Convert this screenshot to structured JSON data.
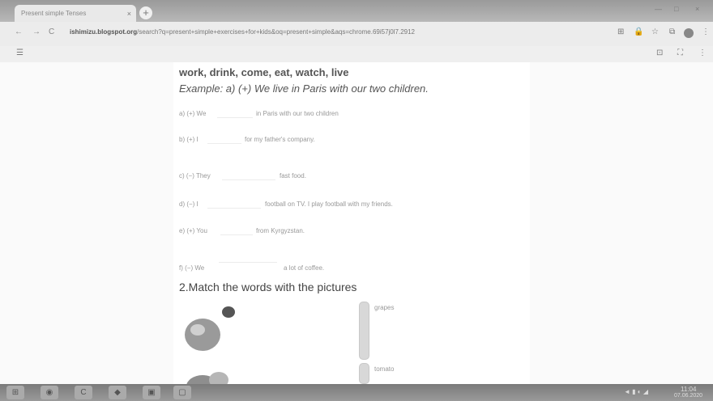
{
  "browser": {
    "tab_title": "Present simple Tenses",
    "tab_close": "×",
    "new_tab": "+",
    "url_host": "ishimizu.blogspot.org",
    "url_path": "/search?q=present+simple+exercises+for+kids&oq=present+simple&aqs=chrome.69i57j0l7.2912",
    "minimize": "—",
    "maximize": "□",
    "close": "×",
    "back": "←",
    "forward": "→",
    "reload": "C",
    "lock": "🔒",
    "star": "☆",
    "menu": "⋮",
    "apps": "⊞",
    "cast": "⊡",
    "ext": "⧉",
    "viewer_menu": "☰",
    "viewer_tools": "⛶",
    "viewer_more": "⋮"
  },
  "worksheet": {
    "word_bank": "work, drink, come, eat, watch, live",
    "example": "Example: a) (+) We live in Paris with our two children.",
    "items": [
      {
        "prefix": "a) (+) We",
        "suffix": "in Paris with our two children"
      },
      {
        "prefix": "b) (+) I",
        "suffix": "for my father's company."
      },
      {
        "prefix": "c) (−) They",
        "suffix": "fast food."
      },
      {
        "prefix": "d) (−) I",
        "suffix": "football on TV. I play football with my friends."
      },
      {
        "prefix": "e) (+) You",
        "suffix": "from Kyrgyzstan."
      },
      {
        "prefix": "f) (−) We",
        "suffix": "a lot of coffee."
      }
    ],
    "section2_title": "2.Match the words with the pictures",
    "fruits": [
      "grapes",
      "tomato"
    ]
  },
  "taskbar": {
    "buttons": [
      "⊞",
      "◉",
      "C",
      "◆",
      "▣",
      "▢"
    ],
    "tray_icons": "◄ ▮ ◐ ◢",
    "clock": "11:04",
    "date": "07.06.2020"
  }
}
